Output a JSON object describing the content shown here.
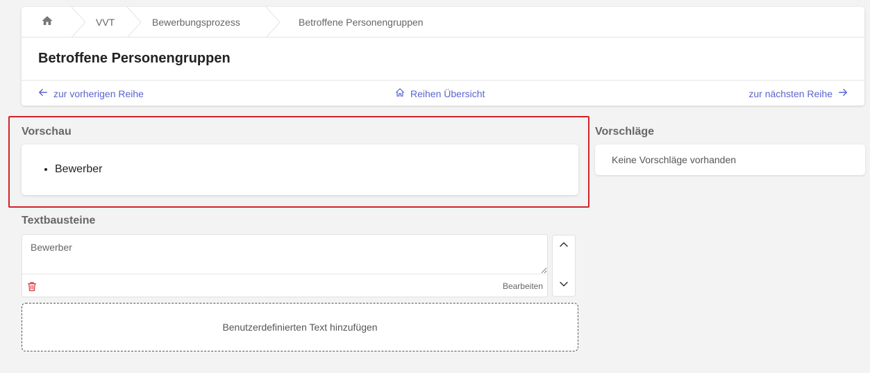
{
  "breadcrumb": {
    "items": [
      {
        "label": "VVT"
      },
      {
        "label": "Bewerbungsprozess"
      },
      {
        "label": "Betroffene Personengruppen"
      }
    ]
  },
  "page": {
    "title": "Betroffene Personengruppen"
  },
  "nav": {
    "prev_label": "zur vorherigen Reihe",
    "overview_label": "Reihen Übersicht",
    "next_label": "zur nächsten Reihe"
  },
  "preview": {
    "title": "Vorschau",
    "items": [
      "Bewerber"
    ]
  },
  "suggestions": {
    "title": "Vorschläge",
    "empty_text": "Keine Vorschläge vorhanden"
  },
  "text_blocks": {
    "title": "Textbausteine",
    "items": [
      {
        "value": "Bewerber",
        "edit_label": "Bearbeiten"
      }
    ],
    "add_custom_label": "Benutzerdefinierten Text hinzufügen"
  },
  "colors": {
    "accent": "#5865d0",
    "highlight": "#d2212a",
    "delete": "#d9383f"
  }
}
